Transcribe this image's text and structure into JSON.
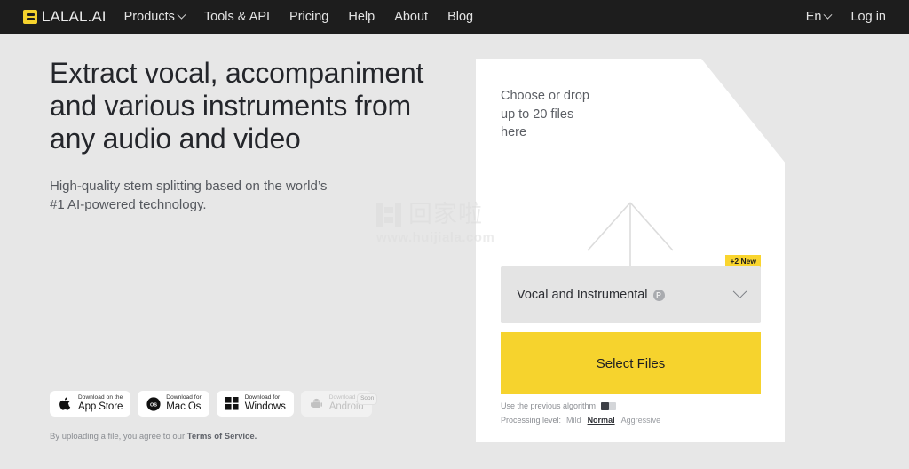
{
  "nav": {
    "logo_icon": "lalal-logo-icon",
    "brand": "LALAL.AI",
    "items": [
      {
        "label": "Products",
        "has_chevron": true
      },
      {
        "label": "Tools & API",
        "has_chevron": false
      },
      {
        "label": "Pricing",
        "has_chevron": false
      },
      {
        "label": "Help",
        "has_chevron": false
      },
      {
        "label": "About",
        "has_chevron": false
      },
      {
        "label": "Blog",
        "has_chevron": false
      }
    ],
    "language": "En",
    "login": "Log in"
  },
  "hero": {
    "heading": "Extract vocal, accompaniment and various instruments from any audio and video",
    "subheading": "High-quality stem splitting based on the world’s #1 AI-powered technology."
  },
  "stores": [
    {
      "top": "Download on the",
      "big": "App Store",
      "icon": "apple-icon",
      "disabled": false,
      "badge": ""
    },
    {
      "top": "Download for",
      "big": "Mac Os",
      "icon": "macos-icon",
      "disabled": false,
      "badge": ""
    },
    {
      "top": "Download for",
      "big": "Windows",
      "icon": "windows-icon",
      "disabled": false,
      "badge": ""
    },
    {
      "top": "Download for",
      "big": "Android",
      "icon": "android-icon",
      "disabled": true,
      "badge": "Soon"
    }
  ],
  "terms": {
    "prefix": "By uploading a file, you agree to our ",
    "link": "Terms of Service."
  },
  "upload": {
    "hint": "Choose or drop\nup to 20 files\nhere",
    "arrow_icon": "upload-arrow-icon",
    "stem_select": {
      "value": "Vocal and Instrumental",
      "pro_badge": "P",
      "new_badge": "+2 New",
      "chevron_icon": "chevron-down-icon"
    },
    "select_files_label": "Select Files",
    "previous_algorithm": {
      "label": "Use the previous algorithm",
      "enabled": false
    },
    "processing": {
      "label": "Processing level:",
      "options": [
        "Mild",
        "Normal",
        "Aggressive"
      ],
      "selected": "Normal"
    }
  },
  "watermark": {
    "text_cn": "回家啦",
    "url": "www.huijiala.com"
  },
  "colors": {
    "nav_bg": "#1d1d1d",
    "page_bg": "#e7e7e7",
    "accent_yellow": "#f6d32d",
    "card_bg": "#ffffff",
    "text_dark": "#24262b",
    "text_muted": "#8b8e93"
  }
}
